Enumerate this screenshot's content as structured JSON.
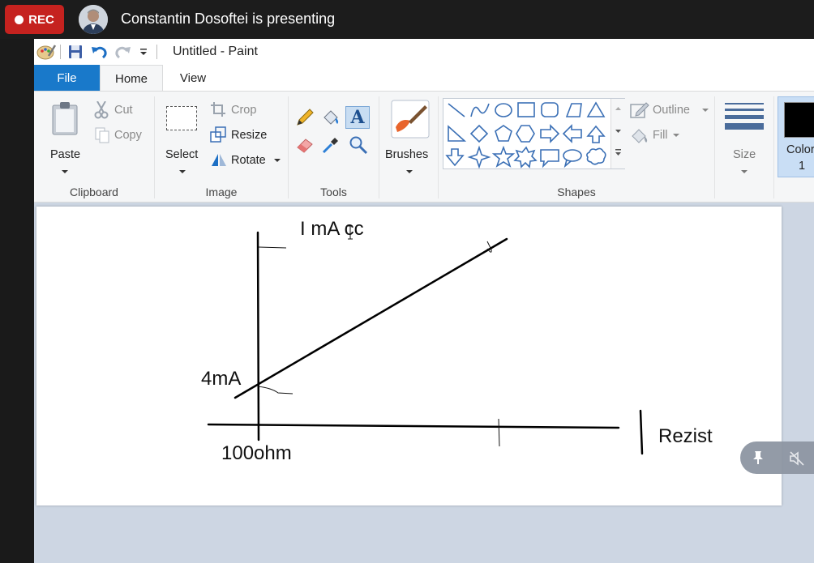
{
  "meeting": {
    "rec_label": "REC",
    "presenter_text": "Constantin Dosoftei is presenting"
  },
  "window": {
    "title": "Untitled - Paint"
  },
  "tabs": {
    "file": "File",
    "home": "Home",
    "view": "View"
  },
  "ribbon": {
    "clipboard": {
      "label": "Clipboard",
      "paste": "Paste",
      "cut": "Cut",
      "copy": "Copy"
    },
    "image": {
      "label": "Image",
      "select": "Select",
      "crop": "Crop",
      "resize": "Resize",
      "rotate": "Rotate"
    },
    "tools": {
      "label": "Tools"
    },
    "brushes": {
      "label": "Brushes"
    },
    "shapes": {
      "label": "Shapes",
      "outline": "Outline",
      "fill": "Fill"
    },
    "size": {
      "label": "Size"
    },
    "color1": {
      "label": "Color",
      "number": "1"
    }
  },
  "canvas_text": {
    "top_label": "I mA cc",
    "y_intercept": "4mA",
    "x_origin": "100ohm",
    "x_axis_label": "Rezist"
  },
  "colors": {
    "accent": "#1979ca",
    "rec": "#c5221f",
    "ribbon_bg": "#f5f6f7",
    "canvas_bg": "#cdd6e3"
  }
}
